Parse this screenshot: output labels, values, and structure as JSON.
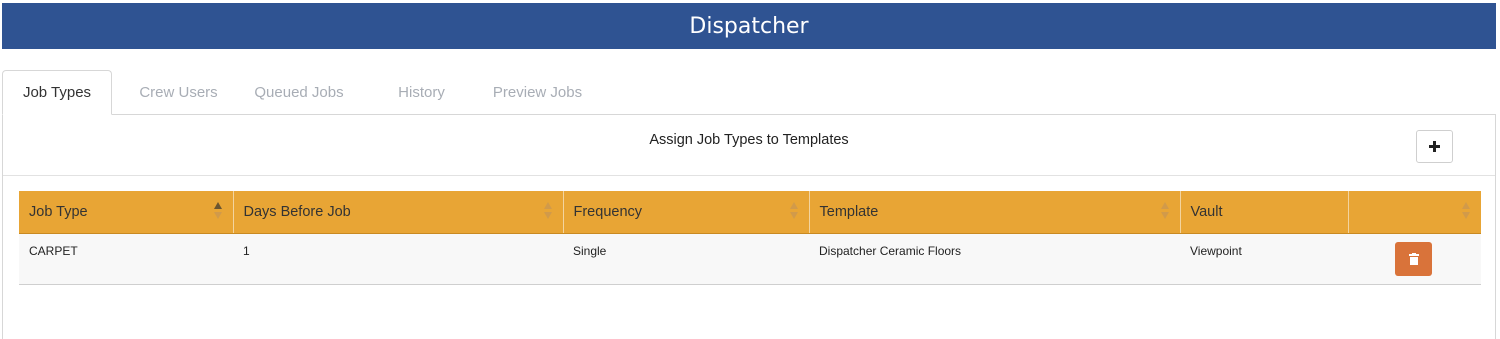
{
  "header": {
    "title": "Dispatcher"
  },
  "tabs": [
    {
      "label": "Job Types",
      "active": true
    },
    {
      "label": "Crew Users",
      "active": false
    },
    {
      "label": "Queued Jobs",
      "active": false
    },
    {
      "label": "History",
      "active": false
    },
    {
      "label": "Preview Jobs",
      "active": false
    }
  ],
  "panel": {
    "title": "Assign Job Types to Templates",
    "add_icon": "plus-icon"
  },
  "table": {
    "columns": [
      "Job Type",
      "Days Before Job",
      "Frequency",
      "Template",
      "Vault",
      ""
    ],
    "sorted_column": "Job Type",
    "rows": [
      {
        "job_type": "CARPET",
        "days_before_job": "1",
        "frequency": "Single",
        "template": "Dispatcher Ceramic Floors",
        "vault": "Viewpoint",
        "action_icon": "trash-icon"
      }
    ]
  },
  "colors": {
    "title_bar": "#2f5392",
    "table_header": "#e8a535",
    "delete_button": "#d9733a"
  }
}
